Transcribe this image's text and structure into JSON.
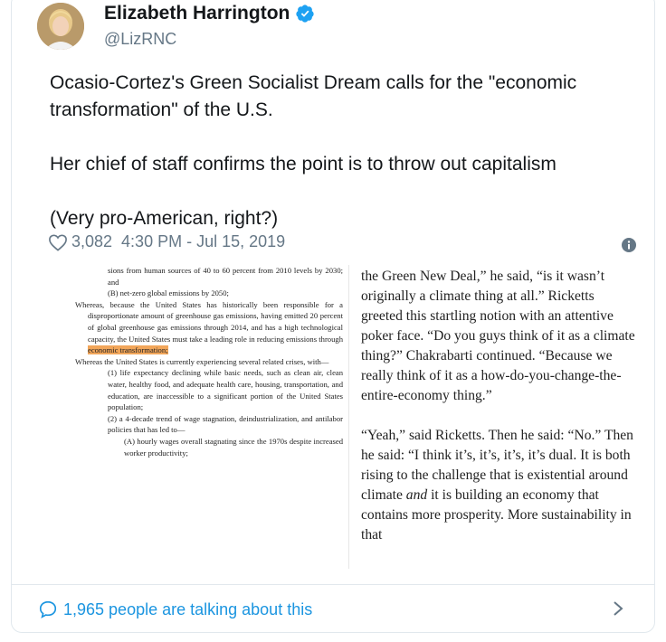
{
  "user": {
    "name": "Elizabeth Harrington",
    "handle": "@LizRNC"
  },
  "tweet": {
    "text": "Ocasio-Cortez's Green Socialist Dream calls for the \"economic transformation\" of the U.S.\n\nHer chief of staff confirms the point is to throw out capitalism\n\n(Very pro-American, right?)",
    "likes": "3,082",
    "timestamp": "4:30 PM - Jul 15, 2019"
  },
  "document_left": {
    "lines": [
      "sions from human sources of 40 to 60 percent from 2010 levels by 2030; and",
      "(B) net-zero global emissions by 2050;",
      "Whereas, because the United States has historically been responsible for a disproportionate amount of greenhouse gas emissions, having emitted 20 percent of global greenhouse gas emissions through 2014, and has a high technological capacity, the United States must take a leading role in reducing emissions through",
      "economic transformation;",
      "Whereas the United States is currently experiencing several related crises, with—",
      "(1) life expectancy declining while basic needs, such as clean air, clean water, healthy food, and adequate health care, housing, transportation, and education, are inaccessible to a significant portion of the United States population;",
      "(2) a 4-decade trend of wage stagnation, deindustrialization, and antilabor policies that has led to—",
      "(A) hourly wages overall stagnating since the 1970s despite increased worker productivity;"
    ]
  },
  "document_right": {
    "paragraph1_start": "the Green New Deal,” he said, “is it wasn’t originally a climate thing at all.” Ricketts greeted this startling notion with an attentive poker face. “Do you guys think of it as a climate thing?” Chakrabarti continued. “Because we really think of it as a how-do-you-change-the-entire-economy thing.”",
    "paragraph2_start": "“Yeah,” said Ricketts. Then he said: “No.” Then he said: “I think it’s, it’s, it’s, it’s dual. It is both rising to the challenge that is existential around climate",
    "paragraph2_italic": "and",
    "paragraph2_end": "it is building an economy that contains more prosperity. More sustainability in that"
  },
  "footer": {
    "talking": "1,965 people are talking about this"
  },
  "colors": {
    "link": "#1b95e0",
    "muted": "#657786",
    "highlight": "#f2a65a"
  },
  "icons": [
    "verified-badge-icon",
    "heart-icon",
    "info-icon",
    "comment-bubble-icon",
    "chevron-right-icon"
  ]
}
